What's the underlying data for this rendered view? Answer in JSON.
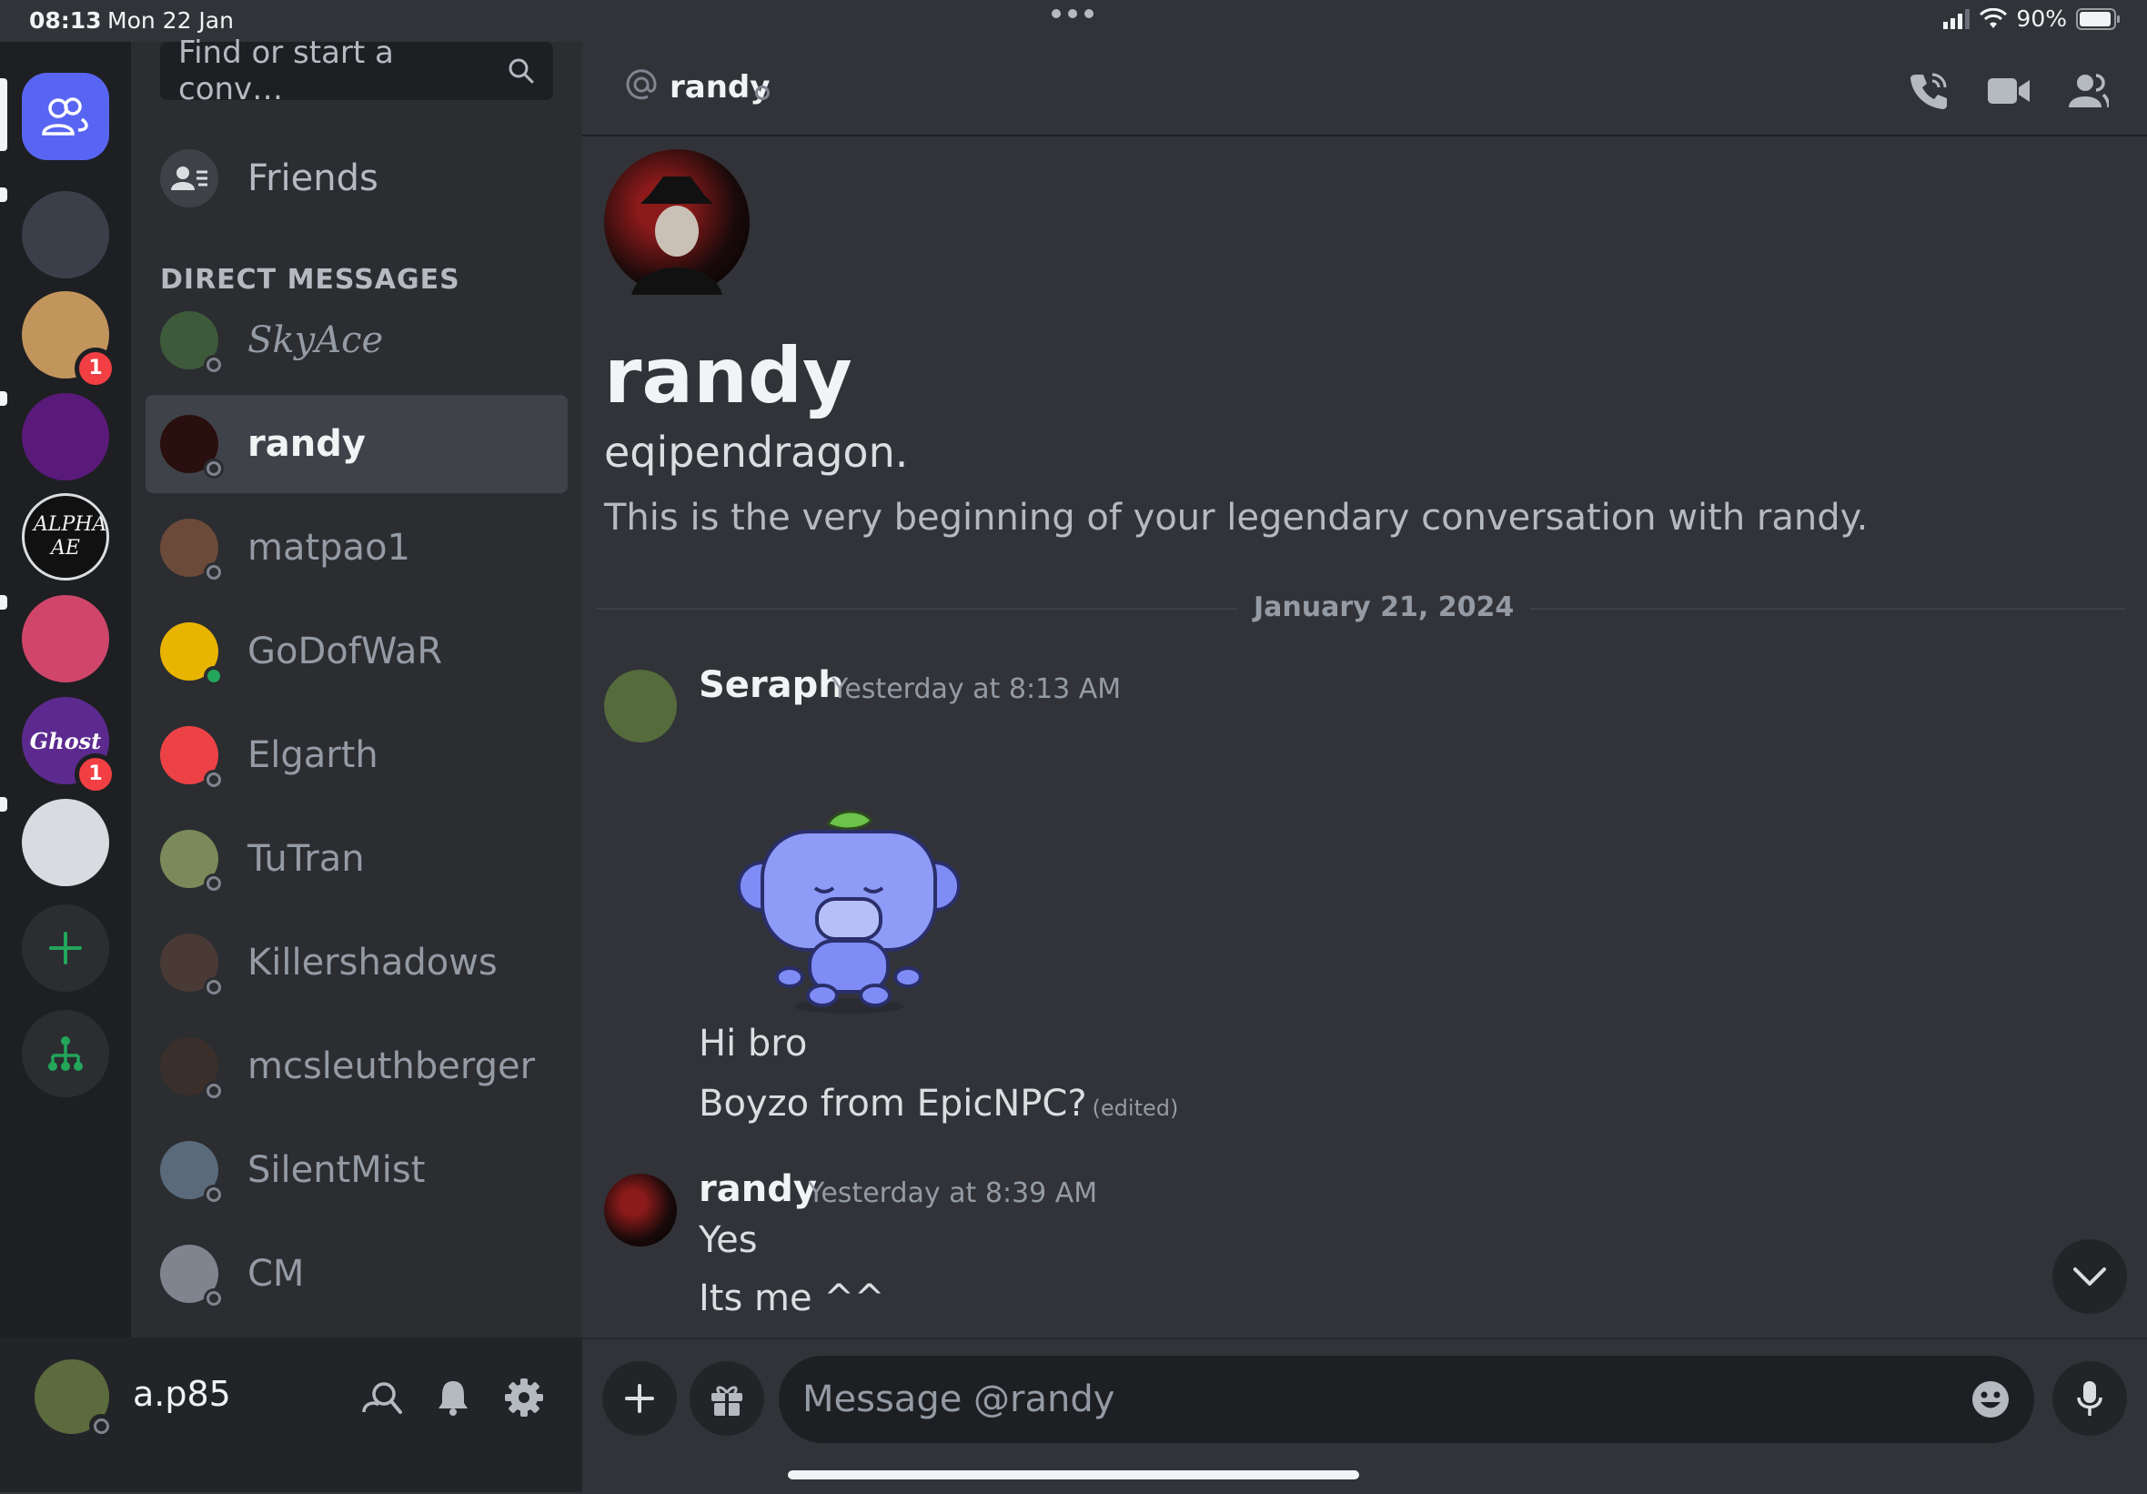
{
  "status_bar": {
    "time": "08:13",
    "date": "Mon 22 Jan",
    "battery": "90%"
  },
  "servers": [
    {
      "name": "server-1",
      "color": "#3a3f4a",
      "unread": true,
      "badge": ""
    },
    {
      "name": "server-2",
      "color": "#c2955c",
      "unread": false,
      "badge": "1"
    },
    {
      "name": "server-3",
      "color": "#5a1a7a",
      "unread": true,
      "badge": ""
    },
    {
      "name": "server-alpha",
      "color": "#111111",
      "unread": false,
      "badge": ""
    },
    {
      "name": "server-5",
      "color": "#d0466b",
      "unread": true,
      "badge": ""
    },
    {
      "name": "server-ghost",
      "color": "#5c2a8f",
      "unread": false,
      "badge": "1"
    },
    {
      "name": "server-ff",
      "color": "#d9dbe0",
      "unread": true,
      "badge": ""
    }
  ],
  "alpha_server_label": "ALPHA AE",
  "ghost_server_label": "Ghost",
  "search": {
    "placeholder": "Find or start a conv…"
  },
  "friends_label": "Friends",
  "dm_section_label": "DIRECT MESSAGES",
  "dms": [
    {
      "name": "SkyAce",
      "status": "offline",
      "avatar_color": "#3d5a3a",
      "style": "script",
      "active": false
    },
    {
      "name": "randy",
      "status": "offline",
      "avatar_color": "#2a0f0f",
      "style": "normal",
      "active": true
    },
    {
      "name": "matpao1",
      "status": "offline",
      "avatar_color": "#6b4a3a",
      "style": "normal",
      "active": false
    },
    {
      "name": "GoDofWaR",
      "status": "online",
      "avatar_color": "#e8b400",
      "style": "normal",
      "active": false
    },
    {
      "name": "Elgarth",
      "status": "offline",
      "avatar_color": "#ed4245",
      "style": "normal",
      "active": false
    },
    {
      "name": "TuTran",
      "status": "offline",
      "avatar_color": "#7a8a5a",
      "style": "normal",
      "active": false
    },
    {
      "name": "Killershadows",
      "status": "offline",
      "avatar_color": "#4a3a36",
      "style": "normal",
      "active": false
    },
    {
      "name": "mcsleuthberger",
      "status": "offline",
      "avatar_color": "#3a2f2a",
      "style": "normal",
      "active": false
    },
    {
      "name": "SilentMist",
      "status": "offline",
      "avatar_color": "#5a6a7a",
      "style": "normal",
      "active": false
    },
    {
      "name": "CM",
      "status": "offline",
      "avatar_color": "#80848e",
      "style": "normal",
      "active": false
    }
  ],
  "user_panel": {
    "username": "a.p85"
  },
  "chat_header": {
    "name": "randy"
  },
  "welcome": {
    "display_name": "randy",
    "username": "eqipendragon.",
    "text": "This is the very beginning of your legendary conversation with randy."
  },
  "date_divider": "January 21, 2024",
  "messages": [
    {
      "author": "Seraph",
      "timestamp": "Yesterday at 8:13 AM",
      "avatar_color": "#556b3c",
      "lines": [
        "Hi bro",
        "Boyzo from EpicNPC?"
      ],
      "edited_label": "(edited)"
    },
    {
      "author": "randy",
      "timestamp": "Yesterday at 8:39 AM",
      "avatar_color": "#2a0f0f",
      "lines": [
        "Yes",
        "Its me ^^"
      ]
    }
  ],
  "composer": {
    "placeholder": "Message @randy"
  },
  "colors": {
    "blurple": "#5865f2",
    "online": "#23a55a",
    "badge": "#f23f43"
  }
}
